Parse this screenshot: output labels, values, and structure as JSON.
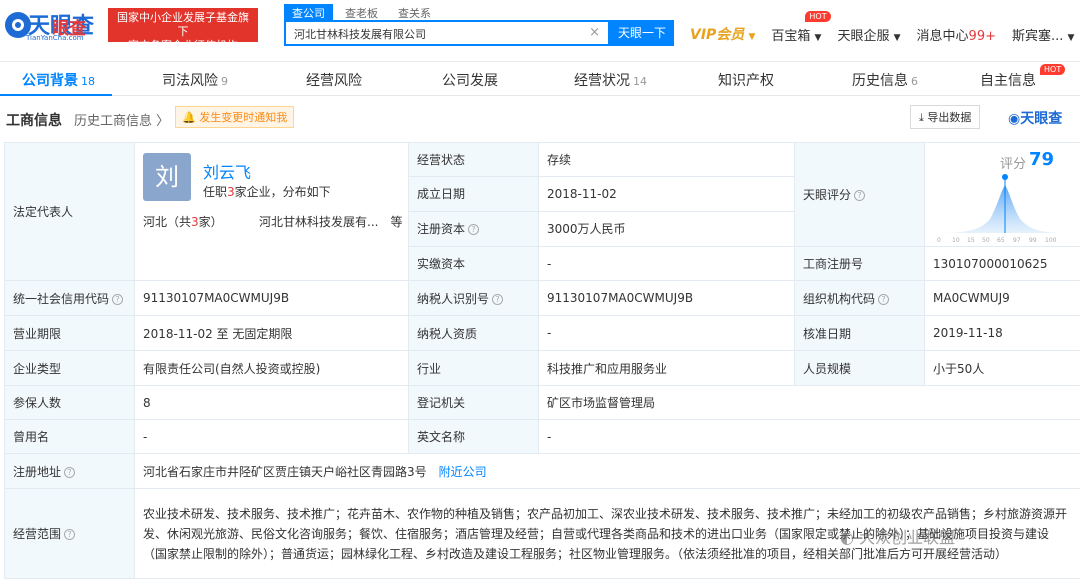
{
  "header": {
    "logo_text": "天眼查",
    "logo_sub": "TianYanCha.com",
    "logo_overlay": "眼查",
    "banner_line1": "国家中小企业发展子基金旗下",
    "banner_line2": "官方备案企业征信机构",
    "search_tabs": [
      "查公司",
      "查老板",
      "查关系"
    ],
    "search_value": "河北甘林科技发展有限公司",
    "search_button": "天眼一下",
    "vip_label": "VIP会员",
    "treasure_label": "百宝箱",
    "hot_label": "HOT",
    "enterprise_label": "天眼企服",
    "message_label": "消息中心",
    "message_count": "99+",
    "user_label": "斯宾塞..."
  },
  "tabs": [
    {
      "label": "公司背景",
      "count": "18"
    },
    {
      "label": "司法风险",
      "count": "9"
    },
    {
      "label": "经营风险",
      "count": ""
    },
    {
      "label": "公司发展",
      "count": ""
    },
    {
      "label": "经营状况",
      "count": "14"
    },
    {
      "label": "知识产权",
      "count": ""
    },
    {
      "label": "历史信息",
      "count": "6"
    },
    {
      "label": "自主信息",
      "count": ""
    }
  ],
  "section": {
    "title": "工商信息",
    "history_link": "历史工商信息 〉",
    "notify": "发生变更时通知我",
    "export": "导出数据",
    "brand": "天眼查"
  },
  "info": {
    "legal_rep_label": "法定代表人",
    "avatar_char": "刘",
    "rep_name": "刘云飞",
    "rep_desc_pre": "任职",
    "rep_desc_count": "3",
    "rep_desc_post": "家企业，分布如下",
    "rep_region_pre": "河北（共",
    "rep_region_count": "3",
    "rep_region_post": "家）",
    "rep_company": "河北甘林科技发展有...　等",
    "status_label": "经营状态",
    "status_value": "存续",
    "found_label": "成立日期",
    "found_value": "2018-11-02",
    "capital_label": "注册资本",
    "capital_value": "3000万人民币",
    "paid_label": "实缴资本",
    "paid_value": "-",
    "score_label_cell": "天眼评分",
    "score_text": "评分",
    "score_value": "79",
    "score_ticks": [
      "0",
      "10",
      "15",
      "50",
      "65",
      "97",
      "99",
      "100"
    ],
    "regno_label": "工商注册号",
    "regno_value": "130107000010625",
    "credit_label": "统一社会信用代码",
    "credit_value": "91130107MA0CWMUJ9B",
    "tax_label": "纳税人识别号",
    "tax_value": "91130107MA0CWMUJ9B",
    "org_label": "组织机构代码",
    "org_value": "MA0CWMUJ9",
    "term_label": "营业期限",
    "term_value": "2018-11-02  至 无固定期限",
    "taxqual_label": "纳税人资质",
    "taxqual_value": "-",
    "approve_label": "核准日期",
    "approve_value": "2019-11-18",
    "type_label": "企业类型",
    "type_value": "有限责任公司(自然人投资或控股)",
    "industry_label": "行业",
    "industry_value": "科技推广和应用服务业",
    "staff_label": "人员规模",
    "staff_value": "小于50人",
    "insured_label": "参保人数",
    "insured_value": "8",
    "authority_label": "登记机关",
    "authority_value": "矿区市场监督管理局",
    "former_label": "曾用名",
    "former_value": "-",
    "english_label": "英文名称",
    "english_value": "-",
    "address_label": "注册地址",
    "address_value": "河北省石家庄市井陉矿区贾庄镇天户峪社区青园路3号",
    "nearby_link": "附近公司",
    "scope_label": "经营范围",
    "scope_value": "农业技术研发、技术服务、技术推广；花卉苗木、农作物的种植及销售；农产品初加工、深农业技术研发、技术服务、技术推广；未经加工的初级农产品销售；乡村旅游资源开发、休闲观光旅游、民俗文化咨询服务；餐饮、住宿服务；酒店管理及经营；自营或代理各类商品和技术的进出口业务（国家限定或禁止的除外）；基础设施项目投资与建设（国家禁止限制的除外）；普通货运；园林绿化工程、乡村改造及建设工程服务；社区物业管理服务。（依法须经批准的项目，经相关部门批准后方可开展经营活动）"
  },
  "watermark": "大众创业联盟",
  "colors": {
    "accent": "#0084ff",
    "label_bg": "#f2f9fc",
    "red": "#e4393c",
    "vip": "#e8a21f"
  }
}
